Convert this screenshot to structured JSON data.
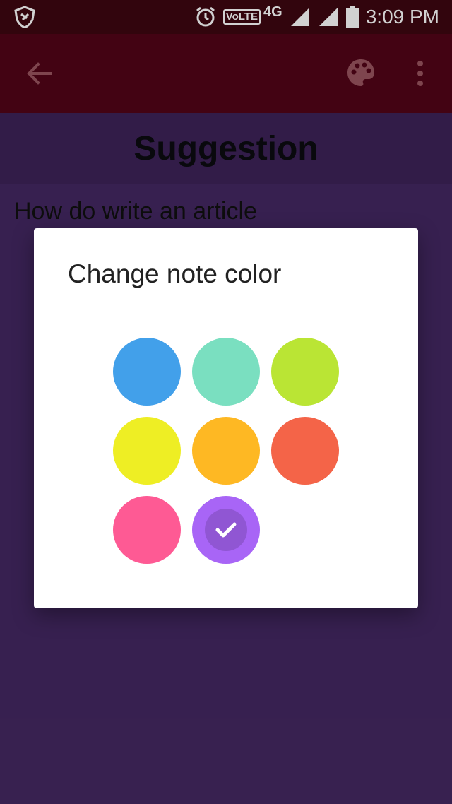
{
  "status_bar": {
    "time": "3:09 PM",
    "volte": "VoLTE",
    "network": "4G",
    "icons": [
      "app-shield-icon",
      "alarm-icon",
      "signal-icon",
      "signal-icon",
      "battery-icon"
    ]
  },
  "app_bar": {
    "icons": [
      "arrow-back-icon",
      "palette-icon",
      "more-vert-icon"
    ],
    "background": "#520418"
  },
  "note": {
    "title": "Suggestion",
    "body": "How do write an article",
    "background": "#442862"
  },
  "dialog": {
    "title": "Change note color",
    "colors": [
      {
        "name": "blue",
        "hex": "#42A0EA",
        "selected": false
      },
      {
        "name": "teal",
        "hex": "#7ADFC0",
        "selected": false
      },
      {
        "name": "lime",
        "hex": "#BAE534",
        "selected": false
      },
      {
        "name": "yellow",
        "hex": "#EEEE24",
        "selected": false
      },
      {
        "name": "orange",
        "hex": "#FEB823",
        "selected": false
      },
      {
        "name": "red-orange",
        "hex": "#F46448",
        "selected": false
      },
      {
        "name": "pink",
        "hex": "#FE5A94",
        "selected": false
      },
      {
        "name": "purple",
        "hex": "#A865F6",
        "selected": true
      }
    ]
  }
}
